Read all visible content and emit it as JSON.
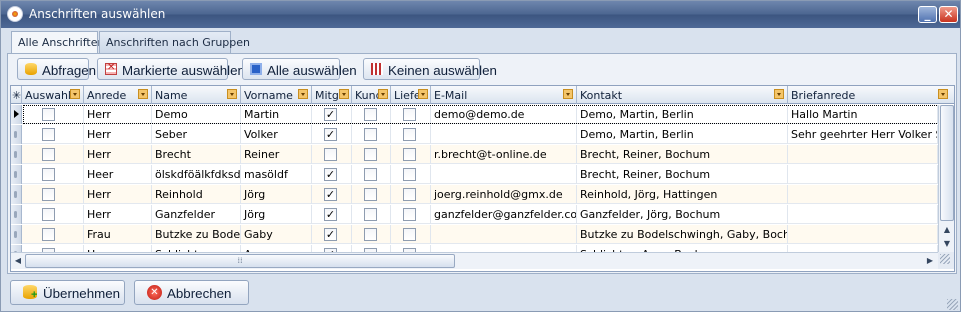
{
  "window": {
    "title": "Anschriften auswählen"
  },
  "tabs": [
    {
      "label": "Alle Anschriften"
    },
    {
      "label": "Anschriften nach Gruppen"
    }
  ],
  "toolbar": {
    "query": "Abfragen",
    "select_marked": "Markierte auswählen",
    "select_all": "Alle auswählen",
    "select_none": "Keinen auswählen"
  },
  "grid": {
    "columns": [
      "Auswahl",
      "Anrede",
      "Name",
      "Vorname",
      "Mitgli",
      "Kund",
      "Liefe",
      "E-Mail",
      "Kontakt",
      "Briefanrede"
    ],
    "rows": [
      {
        "auswahl": false,
        "anrede": "Herr",
        "name": "Demo",
        "vorname": "Martin",
        "mitglied": true,
        "kunde": false,
        "lieferant": false,
        "email": "demo@demo.de",
        "kontakt": "Demo, Martin, Berlin",
        "briefanrede": "Hallo Martin"
      },
      {
        "auswahl": false,
        "anrede": "Herr",
        "name": "Seber",
        "vorname": "Volker",
        "mitglied": true,
        "kunde": false,
        "lieferant": false,
        "email": "",
        "kontakt": "Demo, Martin, Berlin",
        "briefanrede": "Sehr geehrter Herr Volker Seb"
      },
      {
        "auswahl": false,
        "anrede": "Herr",
        "name": "Brecht",
        "vorname": "Reiner",
        "mitglied": false,
        "kunde": false,
        "lieferant": false,
        "email": "r.brecht@t-online.de",
        "kontakt": "Brecht, Reiner, Bochum",
        "briefanrede": ""
      },
      {
        "auswahl": false,
        "anrede": "Heer",
        "name": "ölskdföälkfdksd",
        "vorname": "masöldf",
        "mitglied": true,
        "kunde": false,
        "lieferant": false,
        "email": "",
        "kontakt": "Brecht, Reiner, Bochum",
        "briefanrede": ""
      },
      {
        "auswahl": false,
        "anrede": "Herr",
        "name": "Reinhold",
        "vorname": "Jörg",
        "mitglied": true,
        "kunde": false,
        "lieferant": false,
        "email": "joerg.reinhold@gmx.de",
        "kontakt": "Reinhold, Jörg, Hattingen",
        "briefanrede": ""
      },
      {
        "auswahl": false,
        "anrede": "Herr",
        "name": "Ganzfelder",
        "vorname": "Jörg",
        "mitglied": true,
        "kunde": false,
        "lieferant": false,
        "email": "ganzfelder@ganzfelder.com",
        "kontakt": "Ganzfelder, Jörg, Bochum",
        "briefanrede": ""
      },
      {
        "auswahl": false,
        "anrede": "Frau",
        "name": "Butzke zu Bodelsc",
        "vorname": "Gaby",
        "mitglied": true,
        "kunde": false,
        "lieferant": false,
        "email": "",
        "kontakt": "Butzke zu Bodelschwingh, Gaby, Bochum",
        "briefanrede": ""
      },
      {
        "auswahl": false,
        "anrede": "Herr",
        "name": "Schlichter",
        "vorname": "Arno",
        "mitglied": true,
        "kunde": false,
        "lieferant": false,
        "email": "",
        "kontakt": "Schlichter, Arno, Bochum",
        "briefanrede": ""
      }
    ]
  },
  "footer": {
    "ok": "Übernehmen",
    "cancel": "Abbrechen"
  },
  "icons": {
    "header_corner": "asterisk-icon",
    "filter": "filter-dropdown-icon",
    "check_mark": "✓"
  }
}
